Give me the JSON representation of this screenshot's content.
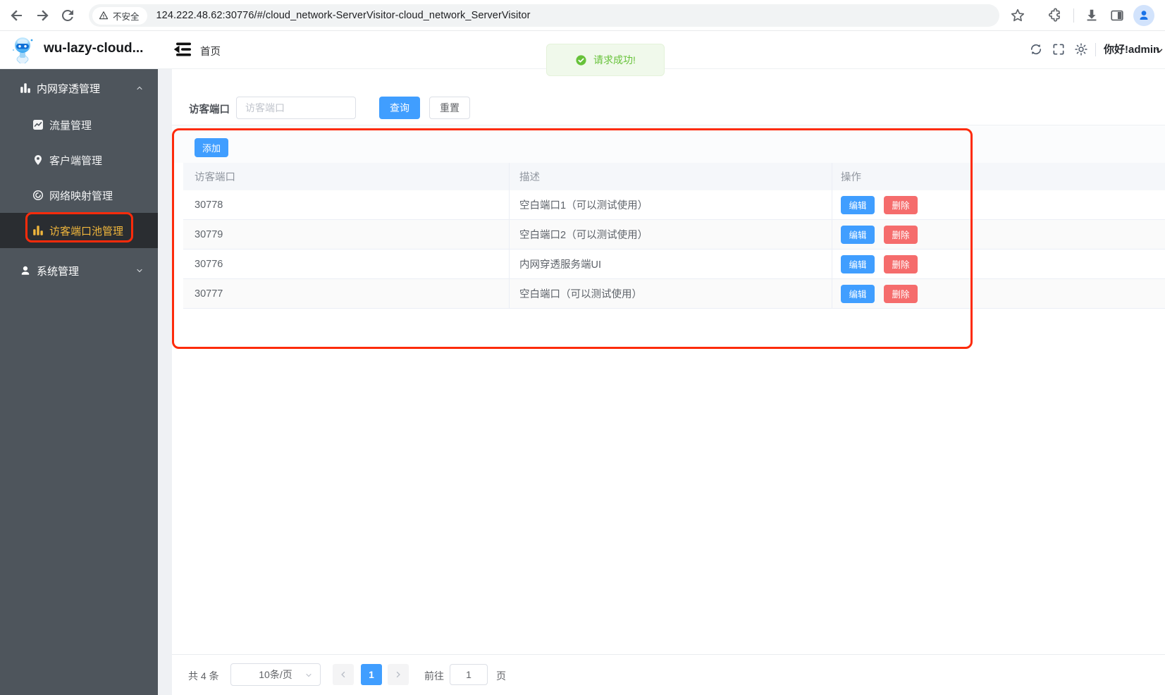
{
  "browser": {
    "security_label": "不安全",
    "url": "124.222.48.62:30776/#/cloud_network-ServerVisitor-cloud_network_ServerVisitor"
  },
  "header": {
    "app_title": "wu-lazy-cloud...",
    "breadcrumb": "首页",
    "greeting": "你好!admin"
  },
  "toast": {
    "message": "请求成功!"
  },
  "sidebar": {
    "items": [
      {
        "label": "内网穿透管理",
        "icon": "bar-chart-icon",
        "state": "expanded"
      },
      {
        "label": "流量管理",
        "icon": "trend-chart-icon"
      },
      {
        "label": "客户端管理",
        "icon": "location-pin-icon"
      },
      {
        "label": "网络映射管理",
        "icon": "link-icon"
      },
      {
        "label": "访客端口池管理",
        "icon": "bar-chart-icon",
        "state": "active"
      },
      {
        "label": "系统管理",
        "icon": "user-icon",
        "state": "collapsed"
      }
    ]
  },
  "filter": {
    "label": "访客端口",
    "placeholder": "访客端口",
    "query_label": "查询",
    "reset_label": "重置"
  },
  "table": {
    "add_label": "添加",
    "columns": [
      "访客端口",
      "描述",
      "操作"
    ],
    "edit_label": "编辑",
    "delete_label": "删除",
    "rows": [
      {
        "port": "30778",
        "desc": "空白端口1（可以测试使用）"
      },
      {
        "port": "30779",
        "desc": "空白端口2（可以测试使用）"
      },
      {
        "port": "30776",
        "desc": "内网穿透服务端UI"
      },
      {
        "port": "30777",
        "desc": "空白端口（可以测试使用）"
      }
    ]
  },
  "pagination": {
    "total": "共 4 条",
    "page_size": "10条/页",
    "current_page": "1",
    "goto_label": "前往",
    "goto_value": "1",
    "unit_label": "页"
  },
  "icons": {
    "toast": "check-circle-icon",
    "security": "warning-triangle-icon",
    "header_tools": [
      "refresh-icon",
      "fullscreen-icon",
      "sun-icon"
    ]
  },
  "colors": {
    "primary": "#409eff",
    "danger": "#f56c6c",
    "success": "#67c23a",
    "sidebar_bg": "#4e555c",
    "sidebar_active_text": "#f0b63c",
    "annotation": "#fd2b0b"
  }
}
